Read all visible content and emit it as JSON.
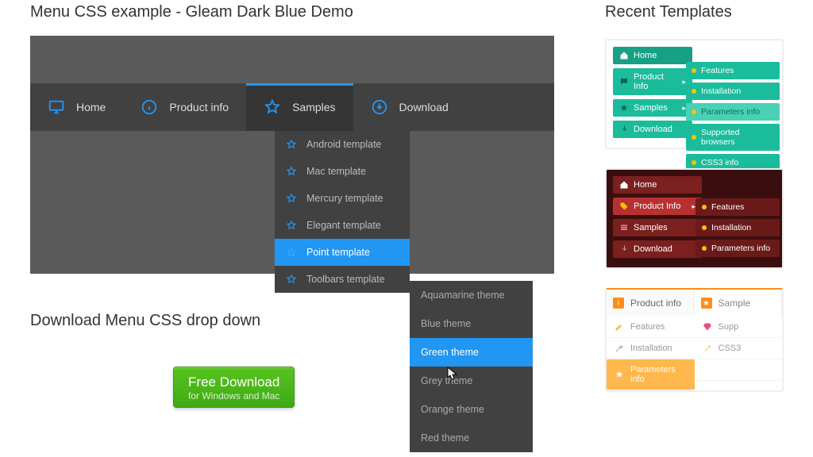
{
  "title": "Menu CSS example - Gleam Dark Blue Demo",
  "main_menu": [
    {
      "label": "Home",
      "icon": "monitor"
    },
    {
      "label": "Product info",
      "icon": "info"
    },
    {
      "label": "Samples",
      "icon": "star",
      "active": true
    },
    {
      "label": "Download",
      "icon": "download"
    }
  ],
  "sub_menu": [
    {
      "label": "Android template"
    },
    {
      "label": "Mac template"
    },
    {
      "label": "Mercury template"
    },
    {
      "label": "Elegant template"
    },
    {
      "label": "Point template",
      "selected": true
    },
    {
      "label": "Toolbars template"
    }
  ],
  "theme_menu": [
    {
      "label": "Aquamarine theme"
    },
    {
      "label": "Blue theme"
    },
    {
      "label": "Green theme",
      "selected": true
    },
    {
      "label": "Grey theme"
    },
    {
      "label": "Orange theme"
    },
    {
      "label": "Red theme"
    }
  ],
  "download_section_title": "Download Menu CSS drop down",
  "download_button": {
    "line1": "Free Download",
    "line2": "for Windows and Mac"
  },
  "right_title": "Recent Templates",
  "tmpl1": {
    "left": [
      "Home",
      "Product Info",
      "Samples",
      "Download"
    ],
    "right": [
      "Features",
      "Installation",
      "Parameters info",
      "Supported browsers",
      "CSS3 info"
    ],
    "right_selected_index": 2
  },
  "tmpl2": {
    "left": [
      "Home",
      "Product Info",
      "Samples",
      "Download"
    ],
    "left_selected_index": 1,
    "right": [
      "Features",
      "Installation",
      "Parameters info"
    ]
  },
  "tmpl3": {
    "tabs": [
      "Product info",
      "Sample"
    ],
    "active_tab": 0,
    "left": [
      "Features",
      "Installation",
      "Parameters info"
    ],
    "left_selected_index": 2,
    "right": [
      "Supp",
      "CSS3"
    ]
  }
}
